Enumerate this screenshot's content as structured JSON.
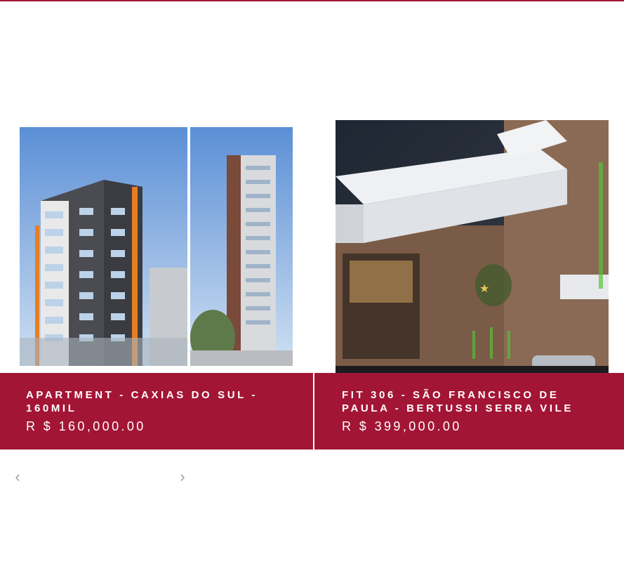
{
  "listings": [
    {
      "title": "APARTMENT - CAXIAS DO SUL - 160MIL",
      "price": "R $ 160,000.00",
      "image": "apartment-tower-render"
    },
    {
      "title": "FIT 306 - SÃO FRANCISCO DE PAULA - BERTUSSI SERRA VILE",
      "price": "R $ 399,000.00",
      "image": "building-facade-night-render"
    }
  ],
  "carousel": {
    "prev_icon": "chevron-left-icon",
    "next_icon": "chevron-right-icon",
    "prev_glyph": "‹",
    "next_glyph": "›"
  },
  "colors": {
    "accent": "#a31535",
    "text_on_accent": "#ffffff",
    "arrow": "#9aa0a6"
  }
}
